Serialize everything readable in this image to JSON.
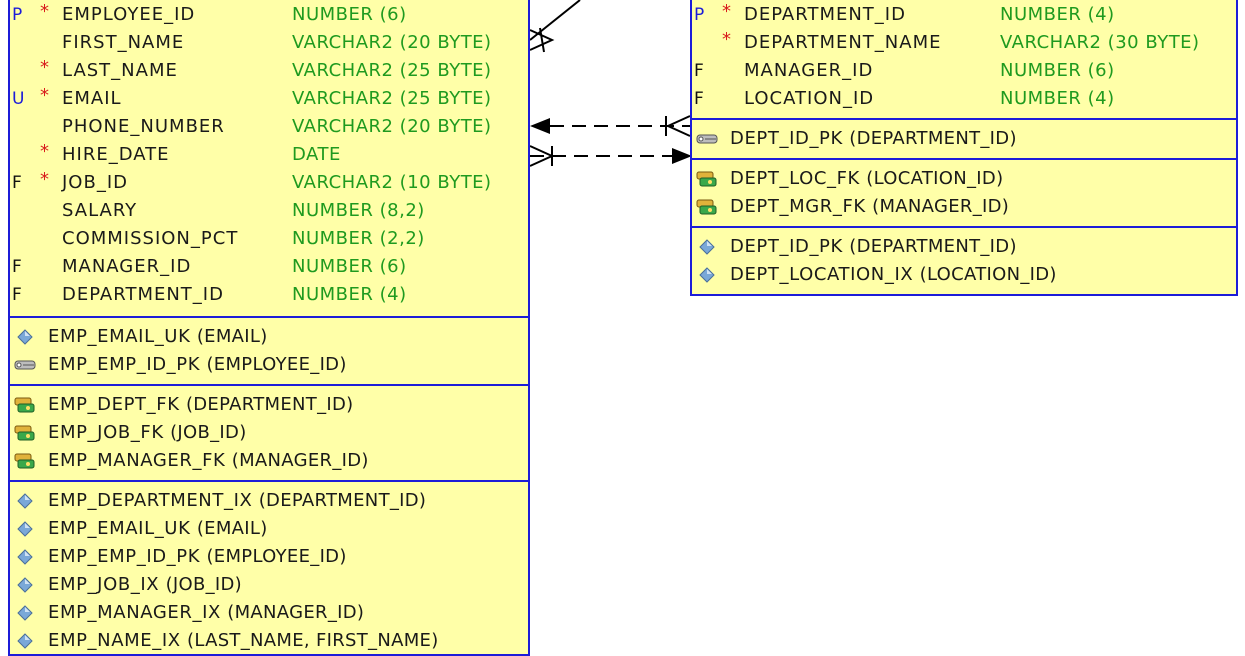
{
  "employees": {
    "columns": [
      {
        "flag": "P",
        "required": true,
        "name": "EMPLOYEE_ID",
        "type": "NUMBER (6)"
      },
      {
        "flag": "",
        "required": false,
        "name": "FIRST_NAME",
        "type": "VARCHAR2 (20 BYTE)"
      },
      {
        "flag": "",
        "required": true,
        "name": "LAST_NAME",
        "type": "VARCHAR2 (25 BYTE)"
      },
      {
        "flag": "U",
        "required": true,
        "name": "EMAIL",
        "type": "VARCHAR2 (25 BYTE)"
      },
      {
        "flag": "",
        "required": false,
        "name": "PHONE_NUMBER",
        "type": "VARCHAR2 (20 BYTE)"
      },
      {
        "flag": "",
        "required": true,
        "name": "HIRE_DATE",
        "type": "DATE"
      },
      {
        "flag": "F",
        "required": true,
        "name": "JOB_ID",
        "type": "VARCHAR2 (10 BYTE)"
      },
      {
        "flag": "",
        "required": false,
        "name": "SALARY",
        "type": "NUMBER (8,2)"
      },
      {
        "flag": "",
        "required": false,
        "name": "COMMISSION_PCT",
        "type": "NUMBER (2,2)"
      },
      {
        "flag": "F",
        "required": false,
        "name": "MANAGER_ID",
        "type": "NUMBER (6)"
      },
      {
        "flag": "F",
        "required": false,
        "name": "DEPARTMENT_ID",
        "type": "NUMBER (4)"
      }
    ],
    "keys": [
      {
        "icon": "diamond",
        "name": "EMP_EMAIL_UK",
        "cols": "(EMAIL)"
      },
      {
        "icon": "key",
        "name": "EMP_EMP_ID_PK",
        "cols": "(EMPLOYEE_ID)"
      }
    ],
    "foreign_keys": [
      {
        "icon": "fk",
        "name": "EMP_DEPT_FK",
        "cols": "(DEPARTMENT_ID)"
      },
      {
        "icon": "fk",
        "name": "EMP_JOB_FK",
        "cols": "(JOB_ID)"
      },
      {
        "icon": "fk",
        "name": "EMP_MANAGER_FK",
        "cols": "(MANAGER_ID)"
      }
    ],
    "indexes": [
      {
        "icon": "diamond",
        "name": "EMP_DEPARTMENT_IX",
        "cols": "(DEPARTMENT_ID)"
      },
      {
        "icon": "diamond",
        "name": "EMP_EMAIL_UK",
        "cols": "(EMAIL)"
      },
      {
        "icon": "diamond",
        "name": "EMP_EMP_ID_PK",
        "cols": "(EMPLOYEE_ID)"
      },
      {
        "icon": "diamond",
        "name": "EMP_JOB_IX",
        "cols": "(JOB_ID)"
      },
      {
        "icon": "diamond",
        "name": "EMP_MANAGER_IX",
        "cols": "(MANAGER_ID)"
      },
      {
        "icon": "diamond",
        "name": "EMP_NAME_IX",
        "cols": "(LAST_NAME, FIRST_NAME)"
      }
    ]
  },
  "departments": {
    "columns": [
      {
        "flag": "P",
        "required": true,
        "name": "DEPARTMENT_ID",
        "type": "NUMBER (4)"
      },
      {
        "flag": "",
        "required": true,
        "name": "DEPARTMENT_NAME",
        "type": "VARCHAR2 (30 BYTE)"
      },
      {
        "flag": "F",
        "required": false,
        "name": "MANAGER_ID",
        "type": "NUMBER (6)"
      },
      {
        "flag": "F",
        "required": false,
        "name": "LOCATION_ID",
        "type": "NUMBER (4)"
      }
    ],
    "keys": [
      {
        "icon": "key",
        "name": "DEPT_ID_PK",
        "cols": "(DEPARTMENT_ID)"
      }
    ],
    "foreign_keys": [
      {
        "icon": "fk",
        "name": "DEPT_LOC_FK",
        "cols": "(LOCATION_ID)"
      },
      {
        "icon": "fk",
        "name": "DEPT_MGR_FK",
        "cols": "(MANAGER_ID)"
      }
    ],
    "indexes": [
      {
        "icon": "diamond",
        "name": "DEPT_ID_PK",
        "cols": "(DEPARTMENT_ID)"
      },
      {
        "icon": "diamond",
        "name": "DEPT_LOCATION_IX",
        "cols": "(LOCATION_ID)"
      }
    ]
  },
  "colors": {
    "table_fill": "#ffffa8",
    "table_border": "#1c1cd8",
    "type_text": "#1f9a1f",
    "required_star": "#d81c1c",
    "pk_flag": "#1c1cd8"
  }
}
